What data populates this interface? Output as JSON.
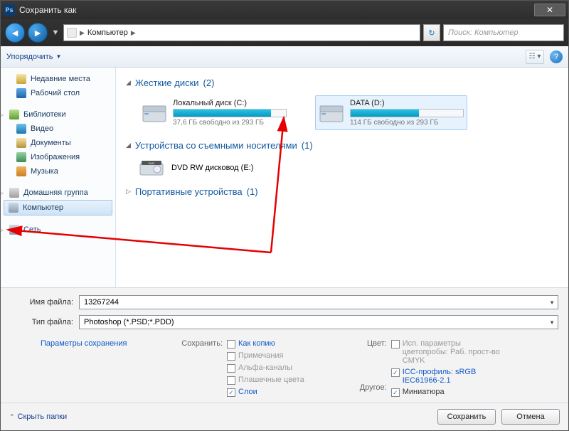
{
  "window": {
    "title": "Сохранить как"
  },
  "nav": {
    "location": "Компьютер",
    "search_placeholder": "Поиск: Компьютер"
  },
  "toolbar": {
    "organize": "Упорядочить"
  },
  "sidebar": {
    "recent": "Недавние места",
    "desktop": "Рабочий стол",
    "libraries": "Библиотеки",
    "video": "Видео",
    "documents": "Документы",
    "images": "Изображения",
    "music": "Музыка",
    "homegroup": "Домашняя группа",
    "computer": "Компьютер",
    "network": "Сеть"
  },
  "sections": {
    "hdd_title": "Жесткие диски",
    "hdd_count": "(2)",
    "removable_title": "Устройства со съемными носителями",
    "removable_count": "(1)",
    "portable_title": "Портативные устройства",
    "portable_count": "(1)"
  },
  "drives": {
    "c": {
      "name": "Локальный диск (C:)",
      "free": "37,6 ГБ свободно из 293 ГБ",
      "fill_pct": 87
    },
    "d": {
      "name": "DATA (D:)",
      "free": "114 ГБ свободно из 293 ГБ",
      "fill_pct": 61
    },
    "dvd": {
      "name": "DVD RW дисковод (E:)"
    }
  },
  "fields": {
    "filename_label": "Имя файла:",
    "filename_value": "13267244",
    "filetype_label": "Тип файла:",
    "filetype_value": "Photoshop (*.PSD;*.PDD)"
  },
  "options": {
    "save_params_link": "Параметры сохранения",
    "save_header": "Сохранить:",
    "as_copy": "Как копию",
    "notes": "Примечания",
    "alpha": "Альфа-каналы",
    "spot": "Плашечные цвета",
    "layers": "Слои",
    "color_header": "Цвет:",
    "proof": "Исп. параметры цветопробы: Раб. прост-во CMYK",
    "icc": "ICC-профиль: sRGB IEC61966-2.1",
    "other_header": "Другое:",
    "thumbnail": "Миниатюра"
  },
  "footer": {
    "hide_folders": "Скрыть папки",
    "save": "Сохранить",
    "cancel": "Отмена"
  }
}
